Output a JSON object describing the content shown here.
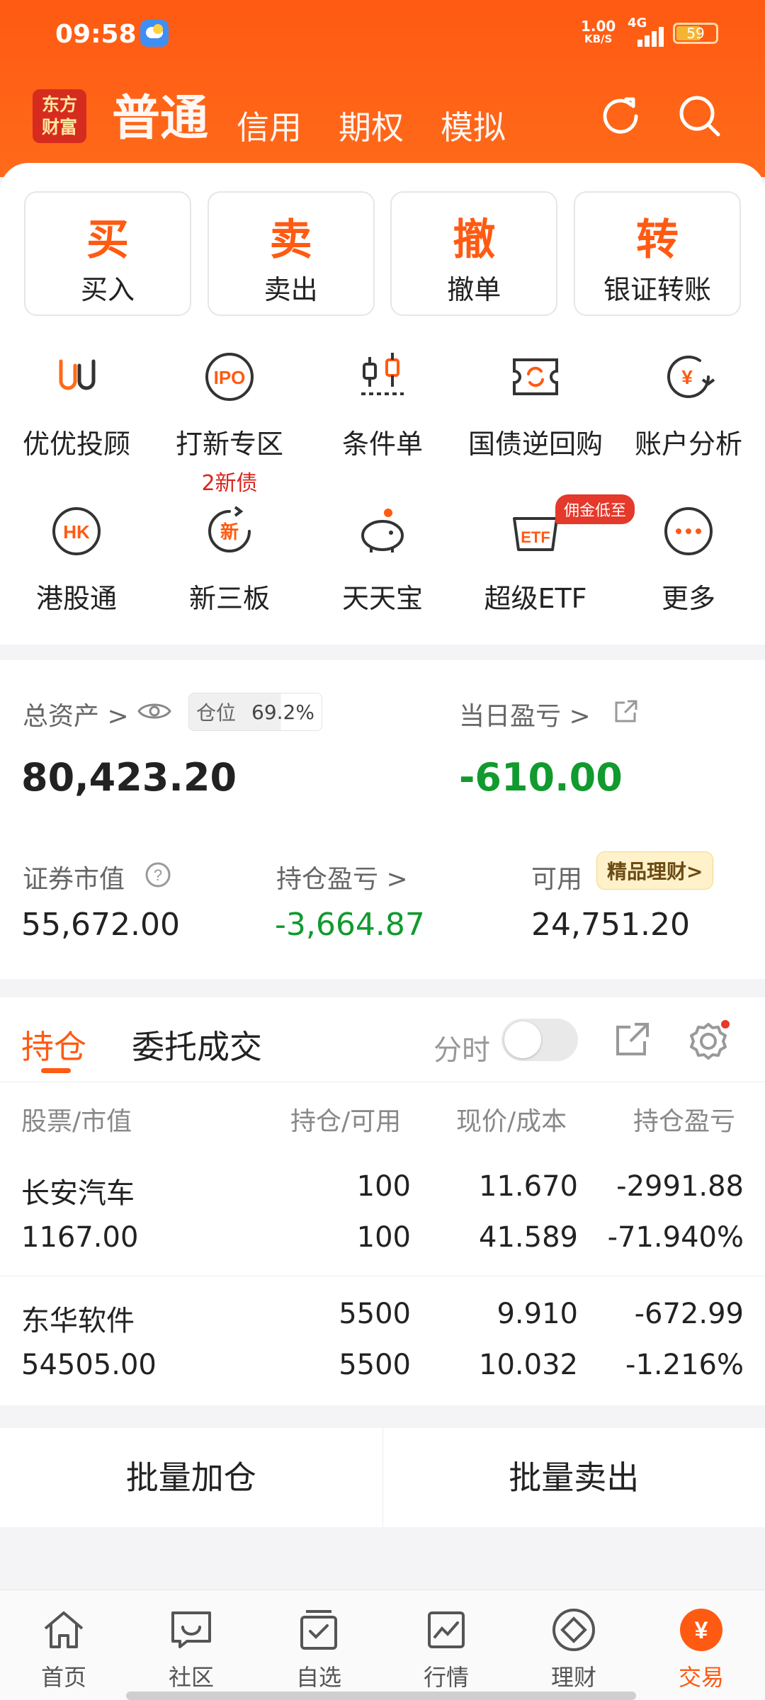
{
  "status": {
    "time": "09:58",
    "net_speed": "1.00",
    "net_unit": "KB/S",
    "signal": "4G",
    "battery": "59"
  },
  "header": {
    "logo_line1": "东方",
    "logo_line2": "财富",
    "tabs": [
      "普通",
      "信用",
      "期权",
      "模拟"
    ]
  },
  "big_buttons": [
    {
      "char": "买",
      "label": "买入"
    },
    {
      "char": "卖",
      "label": "卖出"
    },
    {
      "char": "撤",
      "label": "撤单"
    },
    {
      "char": "转",
      "label": "银证转账"
    }
  ],
  "grid": [
    {
      "icon": "uu-advisor-icon",
      "label": "优优投顾"
    },
    {
      "icon": "ipo-icon",
      "label": "打新专区",
      "sub": "2新债"
    },
    {
      "icon": "condition-order-icon",
      "label": "条件单"
    },
    {
      "icon": "repo-icon",
      "label": "国债逆回购"
    },
    {
      "icon": "account-analysis-icon",
      "label": "账户分析"
    },
    {
      "icon": "hk-icon",
      "label": "港股通"
    },
    {
      "icon": "new-third-board-icon",
      "label": "新三板"
    },
    {
      "icon": "piggy-bank-icon",
      "label": "天天宝"
    },
    {
      "icon": "etf-icon",
      "label": "超级ETF",
      "badge": "佣金低至"
    },
    {
      "icon": "more-icon",
      "label": "更多"
    }
  ],
  "assets": {
    "total_label": "总资产",
    "position_label": "仓位",
    "position_value": "69.2%",
    "position_ratio": 0.692,
    "total_value": "80,423.20",
    "daily_pl_label": "当日盈亏",
    "daily_pl_value": "-610.00",
    "market_value_label": "证券市值",
    "market_value": "55,672.00",
    "holding_pl_label": "持仓盈亏",
    "holding_pl_value": "-3,664.87",
    "available_label": "可用",
    "available_value": "24,751.20",
    "wealth_tag": "精品理财"
  },
  "holdings": {
    "tabs": [
      "持仓",
      "委托成交"
    ],
    "fenshi_label": "分时",
    "columns": [
      "股票/市值",
      "持仓/可用",
      "现价/成本",
      "持仓盈亏"
    ],
    "rows": [
      {
        "name": "长安汽车",
        "market_value": "1167.00",
        "position": "100",
        "available": "100",
        "price": "11.670",
        "cost": "41.589",
        "pl": "-2991.88",
        "pl_pct": "-71.940%"
      },
      {
        "name": "东华软件",
        "market_value": "54505.00",
        "position": "5500",
        "available": "5500",
        "price": "9.910",
        "cost": "10.032",
        "pl": "-672.99",
        "pl_pct": "-1.216%"
      }
    ]
  },
  "actions": [
    "批量加仓",
    "批量卖出"
  ],
  "nav": [
    {
      "icon": "home-icon",
      "label": "首页"
    },
    {
      "icon": "community-icon",
      "label": "社区"
    },
    {
      "icon": "watchlist-icon",
      "label": "自选"
    },
    {
      "icon": "market-icon",
      "label": "行情"
    },
    {
      "icon": "wealth-icon",
      "label": "理财"
    },
    {
      "icon": "trade-icon",
      "label": "交易",
      "active": true
    }
  ],
  "colors": {
    "brand": "#ff5a12",
    "loss": "#119a2e",
    "badge": "#e4392b"
  }
}
